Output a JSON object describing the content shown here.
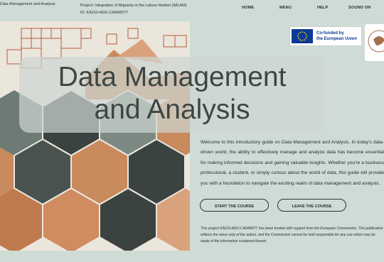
{
  "header": {
    "course_title": "Data Management and Analysis",
    "project_line1": "Project: Integration of Migrants in the Labour Market (IMLAM)",
    "project_line2": "ID: KA210-ADU-CA0A8377"
  },
  "nav": {
    "home": "HOME",
    "menu": "MENU",
    "help": "HELP",
    "sound": "SOUND ON"
  },
  "logos": {
    "eu_line1": "Co-funded by",
    "eu_line2": "the European Union"
  },
  "hero": {
    "title_line1": "Data Management",
    "title_line2": "and Analysis"
  },
  "intro_text": "Welcome to this introductory guide on Data Management and Analysis. In today's data-driven world, the ability to effectively manage and analyze data has become essential for making informed decisions and gaining valuable insights. Whether you're a business professional, a student, or simply curious about the world of data, this guide will provide you with a foundation to navigate the exciting realm of data management and analysis.",
  "buttons": {
    "start": "START THE COURSE",
    "leave": "LEAVE THE COURSE"
  },
  "disclaimer": "This project KA210-ADU-CA0A8377 has been funded with support from the European Commission. This publication reflects the views only of the author, and the Commission cannot be held responsible for any use which may be made of the information contained therein.",
  "colors": {
    "background": "#cfdcd6",
    "eu_blue": "#0b3a96",
    "hex_dark": "#3b4340",
    "hex_orange": "#c98a5e"
  }
}
